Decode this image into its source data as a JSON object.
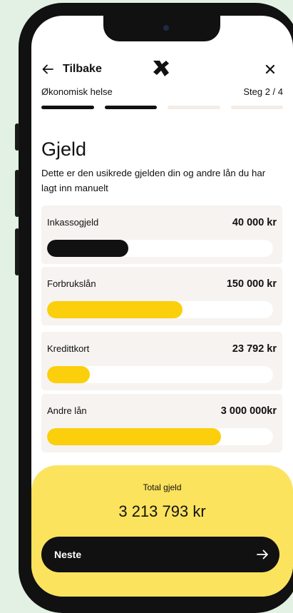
{
  "header": {
    "back_label": "Tilbake",
    "icons": {
      "back": "arrow-left-icon",
      "logo": "brand-logo-icon",
      "close": "close-icon"
    }
  },
  "progress": {
    "section": "Økonomisk helse",
    "step_text": "Steg 2 / 4",
    "current_step": 2,
    "total_steps": 4
  },
  "page": {
    "title": "Gjeld",
    "description": "Dette er den usikrede gjelden din og andre lån du har lagt inn manuelt"
  },
  "debts": [
    {
      "label": "Inkassogjeld",
      "amount": "40 000 kr",
      "fill_fraction": 0.36,
      "color": "#111111"
    },
    {
      "label": "Forbrukslån",
      "amount": "150 000 kr",
      "fill_fraction": 0.6,
      "color": "#fbcf0b"
    },
    {
      "label": "Kredittkort",
      "amount": "23 792 kr",
      "fill_fraction": 0.19,
      "color": "#fbcf0b"
    },
    {
      "label": "Andre lån",
      "amount": "3 000 000kr",
      "fill_fraction": 0.77,
      "color": "#fbcf0b"
    }
  ],
  "total": {
    "label": "Total gjeld",
    "value": "3 213 793 kr"
  },
  "next_button": {
    "label": "Neste",
    "icon": "arrow-right-icon"
  },
  "colors": {
    "accent": "#fbcf0b",
    "panel": "#fce35e",
    "card_bg": "#f6f3f0",
    "page_bg": "#e2f1e3"
  }
}
